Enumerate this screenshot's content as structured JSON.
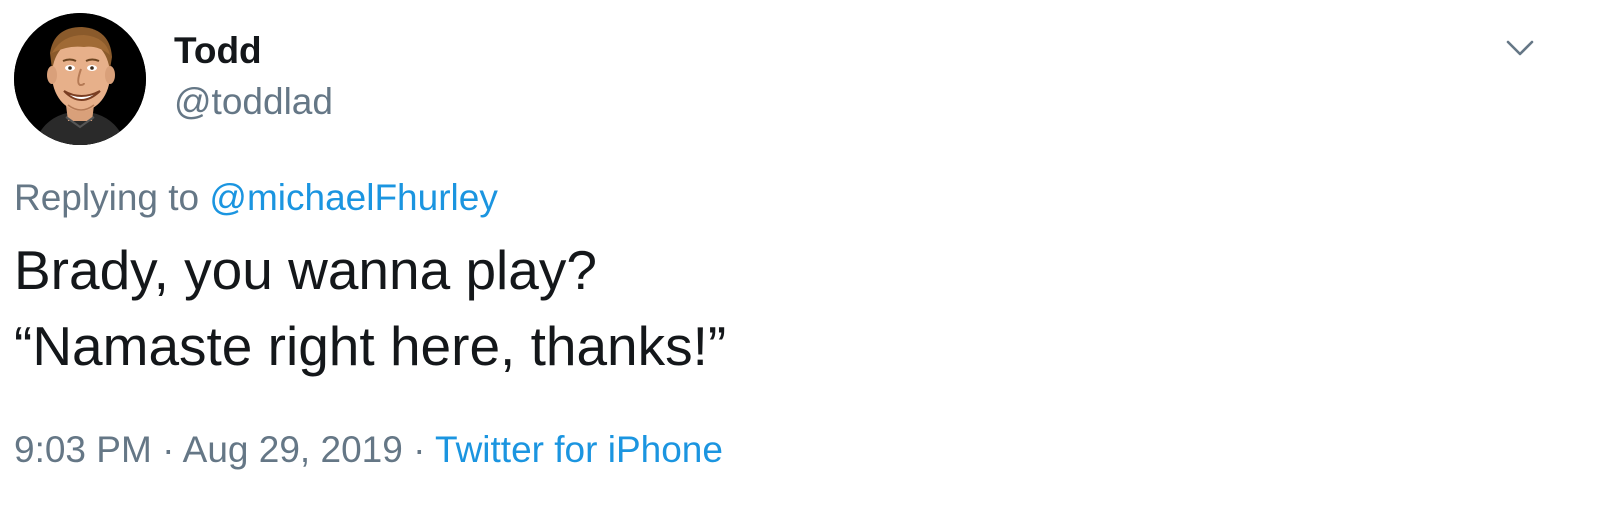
{
  "tweet": {
    "author": {
      "name": "Todd",
      "handle": "@toddlad"
    },
    "replying_prefix": "Replying to",
    "replying_to": "@michaelFhurley",
    "text_lines": [
      "Brady, you wanna play?",
      "“Namaste right here, thanks!”"
    ],
    "time": "9:03 PM",
    "separator": "·",
    "date": "Aug 29, 2019",
    "source": "Twitter for iPhone"
  },
  "icons": {
    "more": "chevron-down-icon"
  },
  "colors": {
    "link": "#1b95e0",
    "secondary_text": "#657786",
    "primary_text": "#14171a"
  }
}
